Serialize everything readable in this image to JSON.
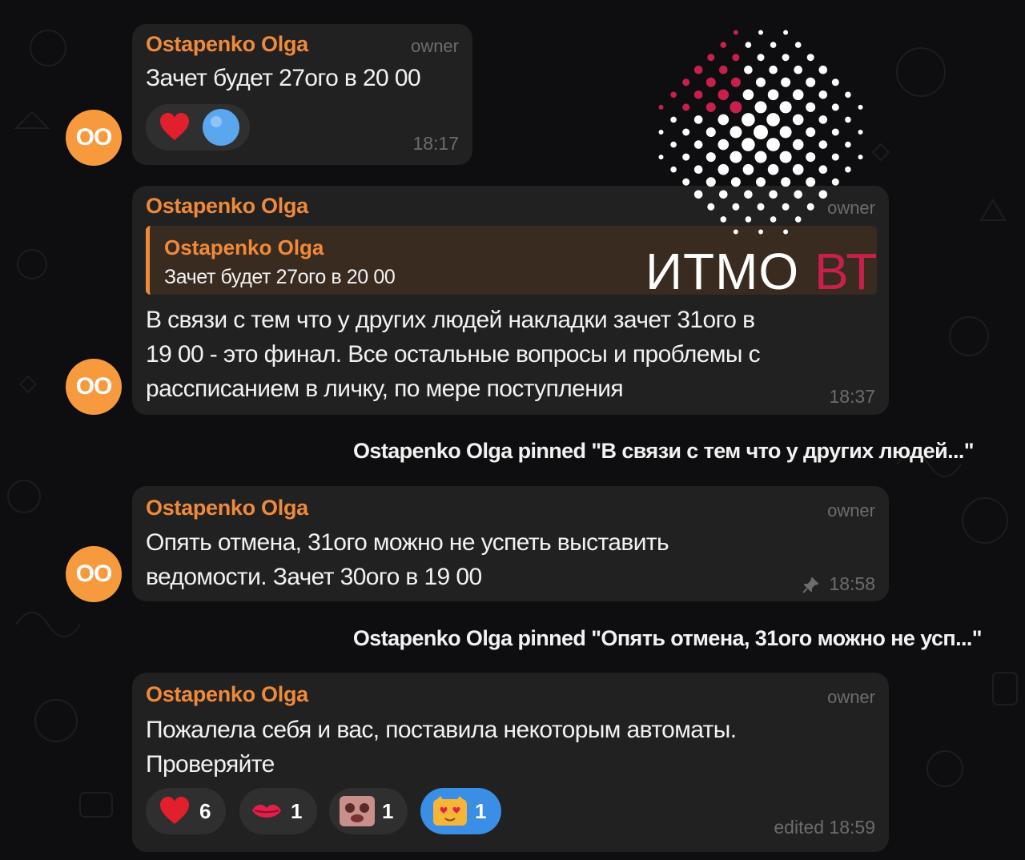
{
  "messages": [
    {
      "sender": "Ostapenko Olga",
      "role": "owner",
      "text_lines": [
        "Зачет будет 27ого в 20 00"
      ],
      "time": "18:17"
    },
    {
      "sender": "Ostapenko Olga",
      "role": "owner",
      "reply": {
        "sender": "Ostapenko Olga",
        "text": "Зачет будет 27ого в 20 00"
      },
      "text_lines": [
        "В связи с тем что у других людей накладки зачет 31ого в",
        "19 00 - это финал. Все остальные вопросы и проблемы с",
        "рассписанием в личку, по мере поступления"
      ],
      "time": "18:37"
    },
    {
      "sender": "Ostapenko Olga",
      "role": "owner",
      "text_lines": [
        "Опять отмена, 31ого можно не успеть выставить",
        "ведомости. Зачет 30ого в 19 00"
      ],
      "time": "18:58"
    },
    {
      "sender": "Ostapenko Olga",
      "role": "owner",
      "text_lines": [
        "Пожалела себя и вас, поставила некоторым автоматы.",
        "Проверяйте"
      ],
      "time": "edited 18:59",
      "reactions": [
        {
          "icon": "heart-icon",
          "count": "6"
        },
        {
          "icon": "kiss-icon",
          "count": "1"
        },
        {
          "icon": "sticker-face-icon",
          "count": "1"
        },
        {
          "icon": "heart-eyes-cat-icon",
          "count": "1"
        }
      ]
    }
  ],
  "service_messages": [
    "Ostapenko Olga pinned \"В связи с тем что у других людей...\"",
    "Ostapenko Olga pinned \"Опять отмена, 31ого можно не усп...\""
  ],
  "avatar_initials": "OO",
  "watermark": {
    "word1": "ИТМО",
    "word2": "ВТ"
  },
  "colors": {
    "background": "#0e0e10",
    "bubble": "#212121",
    "sender": "#f08a3a",
    "avatar": "#f79a3d",
    "reaction_active": "#3a8ee6",
    "logo_accent": "#c8204c"
  }
}
